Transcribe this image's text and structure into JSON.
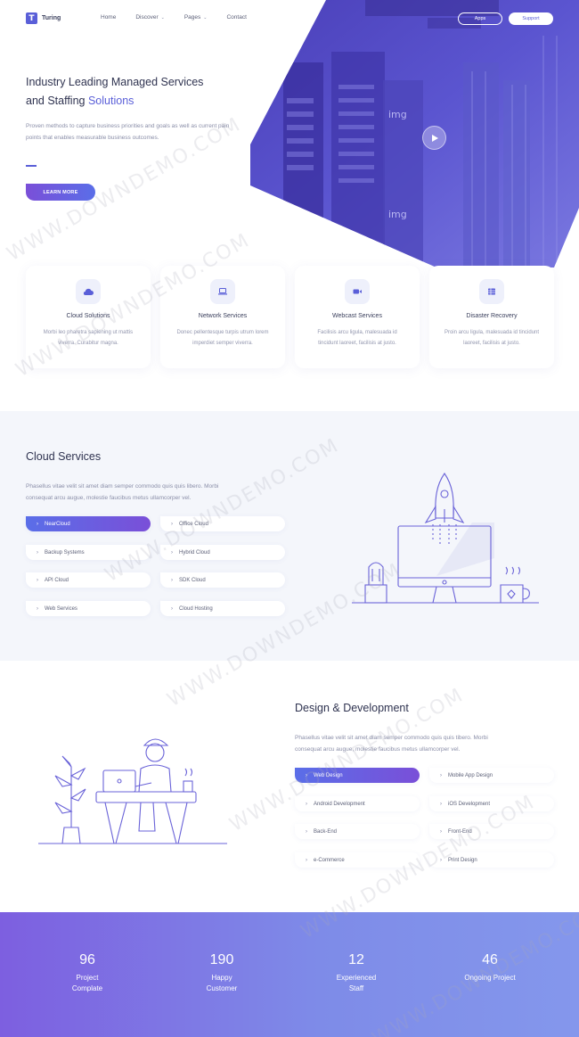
{
  "header": {
    "brand": "Turing",
    "logo_letter": "T",
    "nav": [
      {
        "label": "Home",
        "dropdown": false
      },
      {
        "label": "Discover",
        "dropdown": true
      },
      {
        "label": "Pages",
        "dropdown": true
      },
      {
        "label": "Contact",
        "dropdown": false
      }
    ],
    "apps_label": "Apps",
    "support_label": "Support"
  },
  "hero": {
    "title_line1": "Industry Leading Managed Services",
    "title_line2_prefix": "and Staffing ",
    "title_line2_accent": "Solutions",
    "description": "Proven methods to capture business priorities and goals as well as current pain points that enables measurable business outcomes.",
    "cta_label": "LEARN MORE",
    "image_signs": [
      "img",
      "img"
    ]
  },
  "features": [
    {
      "title": "Cloud Solutions",
      "desc": "Morbi leo pharetra sapiening ut mattis viverra. Curabitur magna.",
      "icon": "cloud-icon"
    },
    {
      "title": "Network Services",
      "desc": "Donec pellentesque turpis utrum lorem imperdiet semper viverra.",
      "icon": "laptop-icon"
    },
    {
      "title": "Webcast Services",
      "desc": "Facilisis arcu ligula, malesuada id tincidunt laoreet, facilisis at justo.",
      "icon": "video-icon"
    },
    {
      "title": "Disaster Recovery",
      "desc": "Proin arcu ligula, malesuada id tincidunt laoreet, facilisis at justo.",
      "icon": "grid-icon"
    }
  ],
  "cloud": {
    "title": "Cloud Services",
    "desc_line1": "Phasellus vitae velit sit amet diam semper commodo quis quis libero. Morbi",
    "desc_line2": "consequat arcu augue, molestie faucibus metus ullamcorper vel.",
    "items": [
      "NearCloud",
      "Office Cloud",
      "Backup Systems",
      "Hybrid Cloud",
      "API Cloud",
      "SDK Cloud",
      "Web Services",
      "Cloud Hosting"
    ],
    "active_index": 0
  },
  "design": {
    "title": "Design & Development",
    "desc_line1": "Phasellus vitae velit sit amet diam semper commodo quis quis tibero. Morbi",
    "desc_line2": "consequat arcu augue, molestie faucibus metus ullamcorper vel.",
    "items": [
      "Web Design",
      "Mobile App Design",
      "Android Development",
      "iOS Development",
      "Back-End",
      "Front-End",
      "e-Commerce",
      "Print Design"
    ],
    "active_index": 0
  },
  "stats": [
    {
      "number": "96",
      "label": "Project Complate"
    },
    {
      "number": "190",
      "label": "Happy Customer"
    },
    {
      "number": "12",
      "label": "Experienced Staff"
    },
    {
      "number": "46",
      "label": "Ongoing Project"
    }
  ],
  "watermark": "WWW.DOWNDEMO.COM",
  "colors": {
    "accent": "#5a5fd8",
    "purple": "#7a4fd8",
    "section_bg": "#f4f6fb",
    "heading": "#2f3350"
  }
}
